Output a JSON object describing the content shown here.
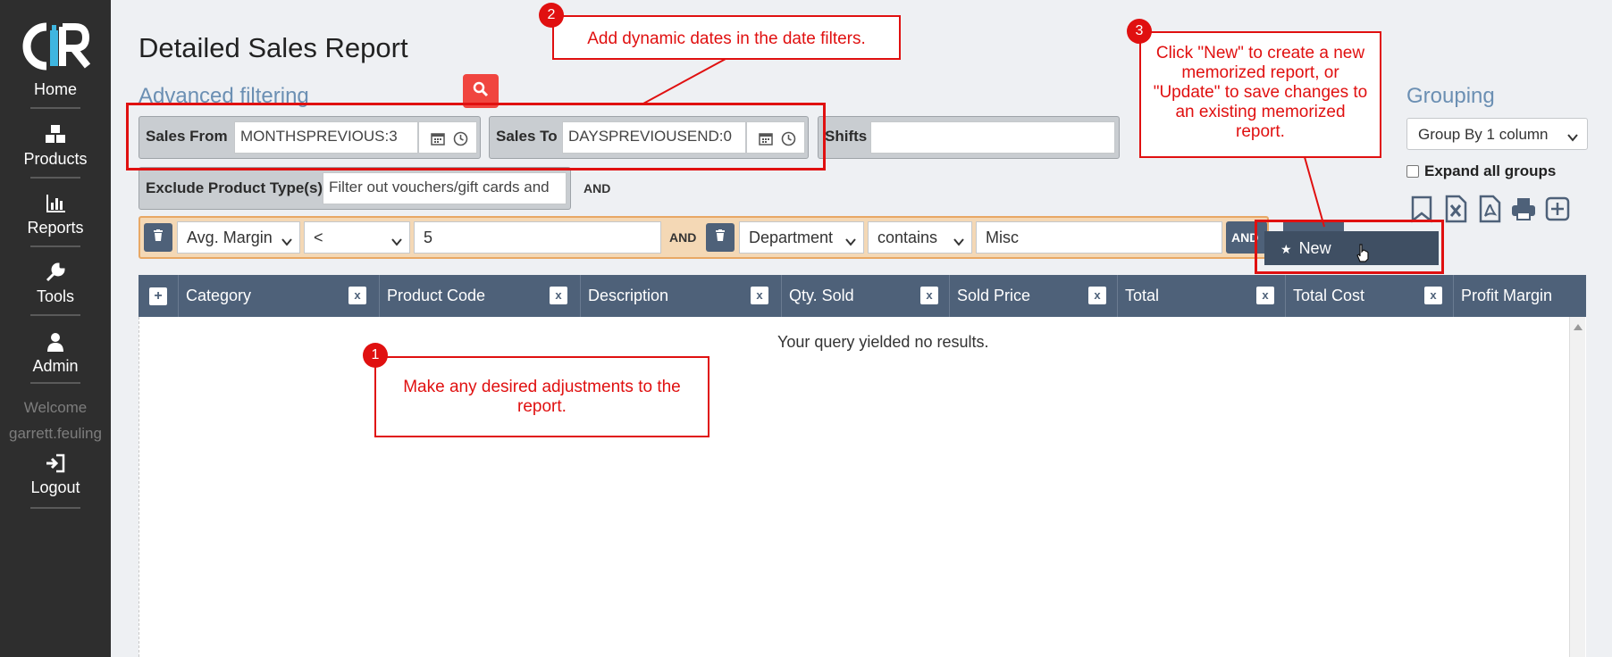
{
  "sidebar": {
    "logo_text": "CR",
    "items": [
      {
        "label": "Home"
      },
      {
        "label": "Products"
      },
      {
        "label": "Reports"
      },
      {
        "label": "Tools"
      },
      {
        "label": "Admin"
      }
    ],
    "welcome": "Welcome",
    "username": "garrett.feuling",
    "logout": "Logout"
  },
  "page": {
    "title": "Detailed Sales Report",
    "advanced_filtering": "Advanced filtering"
  },
  "filters": {
    "sales_from_label": "Sales From",
    "sales_from_value": "MONTHSPREVIOUS:3",
    "sales_to_label": "Sales To",
    "sales_to_value": "DAYSPREVIOUSEND:0",
    "shifts_label": "Shifts",
    "shifts_value": "",
    "exclude_label": "Exclude Product Type(s)",
    "exclude_value": "Filter out vouchers/gift cards and",
    "and_label": "AND"
  },
  "conditions": [
    {
      "field": "Avg. Margin",
      "operator": "<",
      "value": "5"
    },
    {
      "field": "Department",
      "operator": "contains",
      "value": "Misc"
    }
  ],
  "condition_and": "AND",
  "grouping": {
    "title": "Grouping",
    "selected": "Group By 1 column",
    "expand_label": "Expand all groups"
  },
  "memorize_menu": {
    "new_label": "New"
  },
  "table": {
    "columns": [
      "Category",
      "Product Code",
      "Description",
      "Qty. Sold",
      "Sold Price",
      "Total",
      "Total Cost",
      "Profit Margin"
    ],
    "remove_label": "x",
    "add_label": "+",
    "empty_message": "Your query yielded no results."
  },
  "annotations": [
    {
      "number": "1",
      "text": "Make any desired adjustments to the report."
    },
    {
      "number": "2",
      "text": "Add dynamic dates in the date filters."
    },
    {
      "number": "3",
      "text": "Click \"New\" to create a new memorized report, or \"Update\" to save changes to an existing memorized report."
    }
  ],
  "colors": {
    "sidebar": "#2e2e2e",
    "table_header": "#4e6179",
    "accent_blue": "#6b8fb3",
    "annotation_red": "#e01010",
    "search_button": "#f0453f"
  }
}
